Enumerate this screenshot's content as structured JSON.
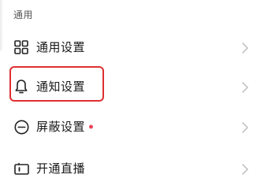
{
  "section": {
    "title": "通用"
  },
  "menu": {
    "items": [
      {
        "label": "通用设置",
        "icon": "grid-icon",
        "has_dot": false
      },
      {
        "label": "通知设置",
        "icon": "bell-icon",
        "has_dot": false
      },
      {
        "label": "屏蔽设置",
        "icon": "minus-circle-icon",
        "has_dot": true
      },
      {
        "label": "开通直播",
        "icon": "live-camera-icon",
        "has_dot": false
      }
    ]
  },
  "colors": {
    "highlight": "#e02f2f",
    "badge_dot": "#e8455a",
    "chevron": "#bdbdbd",
    "icon": "#222222"
  }
}
